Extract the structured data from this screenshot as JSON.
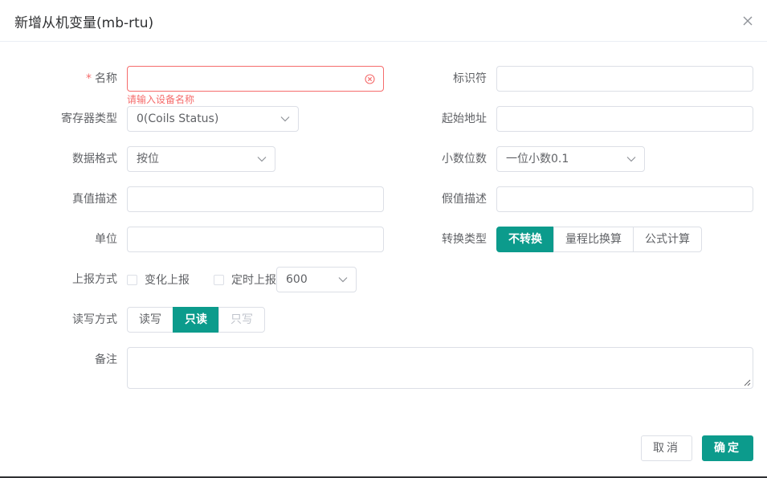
{
  "dialog": {
    "title": "新增从机变量(mb-rtu)"
  },
  "form": {
    "name": {
      "label": "名称",
      "required_mark": "*",
      "value": "",
      "error": "请输入设备名称"
    },
    "identifier": {
      "label": "标识符",
      "value": ""
    },
    "register_type": {
      "label": "寄存器类型",
      "selected": "0(Coils Status)"
    },
    "start_address": {
      "label": "起始地址",
      "value": ""
    },
    "data_format": {
      "label": "数据格式",
      "selected": "按位"
    },
    "decimal_places": {
      "label": "小数位数",
      "selected": "一位小数0.1"
    },
    "true_desc": {
      "label": "真值描述",
      "value": ""
    },
    "false_desc": {
      "label": "假值描述",
      "value": ""
    },
    "unit": {
      "label": "单位",
      "value": ""
    },
    "conversion_type": {
      "label": "转换类型",
      "options": [
        "不转换",
        "量程比换算",
        "公式计算"
      ],
      "selected": "不转换"
    },
    "report_mode": {
      "label": "上报方式",
      "on_change": "变化上报",
      "timed": "定时上报",
      "interval": "600"
    },
    "rw_mode": {
      "label": "读写方式",
      "options": [
        "读写",
        "只读",
        "只写"
      ],
      "selected": "只读"
    },
    "remark": {
      "label": "备注",
      "value": ""
    }
  },
  "footer": {
    "cancel_label": "取消",
    "ok_label": "确定"
  },
  "colors": {
    "accent": "#0c9b8c",
    "error": "#f56c6c",
    "border": "#dcdfe6"
  }
}
